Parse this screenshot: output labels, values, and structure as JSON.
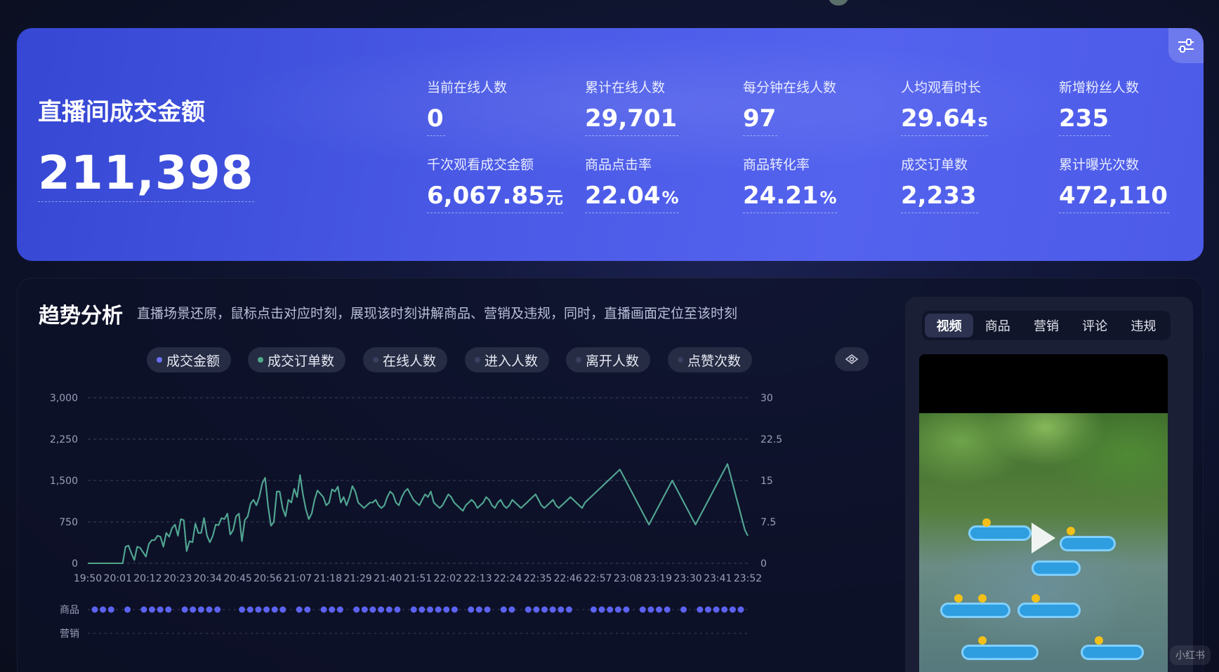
{
  "hero": {
    "title": "直播间成交金额",
    "value": "211,398",
    "metrics": [
      {
        "label": "当前在线人数",
        "value": "0",
        "unit": ""
      },
      {
        "label": "累计在线人数",
        "value": "29,701",
        "unit": ""
      },
      {
        "label": "每分钟在线人数",
        "value": "97",
        "unit": ""
      },
      {
        "label": "人均观看时长",
        "value": "29.64",
        "unit": "s"
      },
      {
        "label": "新增粉丝人数",
        "value": "235",
        "unit": ""
      },
      {
        "label": "千次观看成交金额",
        "value": "6,067.85",
        "unit": "元"
      },
      {
        "label": "商品点击率",
        "value": "22.04",
        "unit": "%"
      },
      {
        "label": "商品转化率",
        "value": "24.21",
        "unit": "%"
      },
      {
        "label": "成交订单数",
        "value": "2,233",
        "unit": ""
      },
      {
        "label": "累计曝光次数",
        "value": "472,110",
        "unit": ""
      }
    ]
  },
  "trend": {
    "title": "趋势分析",
    "description": "直播场景还原，鼠标点击对应时刻，展现该时刻讲解商品、营销及违规，同时，直播画面定位至该时刻",
    "legend": [
      {
        "label": "成交金额",
        "color": "#6a6ff5"
      },
      {
        "label": "成交订单数",
        "color": "#4fa88a"
      },
      {
        "label": "在线人数",
        "color": "#3a4060"
      },
      {
        "label": "进入人数",
        "color": "#3a4060"
      },
      {
        "label": "离开人数",
        "color": "#3a4060"
      },
      {
        "label": "点赞次数",
        "color": "#3a4060"
      }
    ],
    "row_labels": [
      "商品",
      "营销"
    ]
  },
  "video_panel": {
    "tabs": [
      "视频",
      "商品",
      "营销",
      "评论",
      "违规"
    ],
    "active_tab": "视频"
  },
  "watermark": "小红书",
  "chart_data": {
    "type": "line",
    "x_ticks": [
      "19:50",
      "20:01",
      "20:12",
      "20:23",
      "20:34",
      "20:45",
      "20:56",
      "21:07",
      "21:18",
      "21:29",
      "21:40",
      "21:51",
      "22:02",
      "22:13",
      "22:24",
      "22:35",
      "22:46",
      "22:57",
      "23:08",
      "23:19",
      "23:30",
      "23:41",
      "23:52"
    ],
    "ylim_left": [
      0,
      3000
    ],
    "yticks_left": [
      "0",
      "750",
      "1,500",
      "2,250",
      "3,000"
    ],
    "ylim_right": [
      0,
      30
    ],
    "yticks_right": [
      "0",
      "7.5",
      "15",
      "22.5",
      "30"
    ],
    "series": [
      {
        "name": "成交金额",
        "color": "#6a6ff5",
        "axis": "left",
        "values": [
          0,
          0,
          0,
          0,
          0,
          0,
          0,
          0,
          0,
          0,
          0,
          0,
          0,
          300,
          320,
          180,
          60,
          300,
          280,
          200,
          120,
          350,
          420,
          420,
          500,
          480,
          300,
          550,
          480,
          640,
          700,
          500,
          800,
          780,
          220,
          400,
          380,
          720,
          550,
          550,
          820,
          500,
          380,
          500,
          700,
          690,
          820,
          800,
          900,
          520,
          600,
          850,
          900,
          400,
          780,
          850,
          1080,
          1150,
          1050,
          1200,
          1450,
          1550,
          1040,
          680,
          750,
          1300,
          1300,
          1000,
          850,
          1150,
          1100,
          1350,
          1200,
          1600,
          1250,
          980,
          800,
          900,
          1150,
          1320,
          1260,
          1200,
          1050,
          1100,
          1340,
          1300,
          1390,
          1100,
          1200,
          1050,
          1200,
          1400,
          1300,
          1100,
          1050,
          1000,
          1050,
          1100,
          1100,
          1150,
          1050,
          1000,
          1050,
          1200,
          1300,
          1250,
          1100,
          1050,
          1200,
          1300,
          1350,
          1250,
          1150,
          1100,
          1050,
          1150,
          1250,
          1200,
          1300,
          1100,
          1050,
          1000,
          1050,
          1150,
          1250,
          1200,
          1100,
          1050,
          1000,
          950,
          1050,
          1100,
          1150,
          1100,
          1000,
          1050,
          1100,
          1200,
          1150,
          1050,
          1000,
          1100,
          1150,
          1050,
          1000,
          1050,
          1150,
          1100,
          1050,
          1000,
          1050,
          1100,
          1150,
          1200,
          1250,
          1150,
          1050,
          1000,
          1050,
          1100,
          1150,
          1050,
          1000,
          1050,
          1100,
          1150,
          1200,
          1150,
          1100,
          1050,
          1000,
          1100,
          1150,
          1200,
          1250,
          1300,
          1350,
          1400,
          1450,
          1500,
          1550,
          1600,
          1650,
          1700,
          1600,
          1500,
          1400,
          1300,
          1200,
          1100,
          1000,
          900,
          800,
          700,
          800,
          900,
          1000,
          1100,
          1200,
          1300,
          1400,
          1500,
          1400,
          1300,
          1200,
          1100,
          1000,
          900,
          800,
          700,
          800,
          900,
          1000,
          1100,
          1200,
          1300,
          1400,
          1500,
          1600,
          1700,
          1800,
          1600,
          1400,
          1200,
          1000,
          800,
          600,
          500
        ]
      },
      {
        "name": "成交订单数",
        "color": "#4fa88a",
        "axis": "right",
        "values": [
          0,
          0,
          0,
          0,
          0,
          0,
          0,
          0,
          0,
          0,
          0,
          0,
          0,
          3,
          3.2,
          1.8,
          0.6,
          3,
          2.8,
          2,
          1.2,
          3.5,
          4.2,
          4.2,
          5,
          4.8,
          3,
          5.5,
          4.8,
          6.4,
          7,
          5,
          8,
          7.8,
          2.2,
          4,
          3.8,
          7.2,
          5.5,
          5.5,
          8.2,
          5,
          3.8,
          5,
          7,
          6.9,
          8.2,
          8,
          9,
          5.2,
          6,
          8.5,
          9,
          4,
          7.8,
          8.5,
          10.8,
          11.5,
          10.5,
          12,
          14.5,
          15.5,
          10.4,
          6.8,
          7.5,
          13,
          13,
          10,
          8.5,
          11.5,
          11,
          13.5,
          12,
          16,
          12.5,
          9.8,
          8,
          9,
          11.5,
          13.2,
          12.6,
          12,
          10.5,
          11,
          13.4,
          13,
          13.9,
          11,
          12,
          10.5,
          12,
          14,
          13,
          11,
          10.5,
          10,
          10.5,
          11,
          11,
          11.5,
          10.5,
          10,
          10.5,
          12,
          13,
          12.5,
          11,
          10.5,
          12,
          13,
          13.5,
          12.5,
          11.5,
          11,
          10.5,
          11.5,
          12.5,
          12,
          13,
          11,
          10.5,
          10,
          10.5,
          11.5,
          12.5,
          12,
          11,
          10.5,
          10,
          9.5,
          10.5,
          11,
          11.5,
          11,
          10,
          10.5,
          11,
          12,
          11.5,
          10.5,
          10,
          11,
          11.5,
          10.5,
          10,
          10.5,
          11.5,
          11,
          10.5,
          10,
          10.5,
          11,
          11.5,
          12,
          12.5,
          11.5,
          10.5,
          10,
          10.5,
          11,
          11.5,
          10.5,
          10,
          10.5,
          11,
          11.5,
          12,
          11.5,
          11,
          10.5,
          10,
          11,
          11.5,
          12,
          12.5,
          13,
          13.5,
          14,
          14.5,
          15,
          15.5,
          16,
          16.5,
          17,
          16,
          15,
          14,
          13,
          12,
          11,
          10,
          9,
          8,
          7,
          8,
          9,
          10,
          11,
          12,
          13,
          14,
          15,
          14,
          13,
          12,
          11,
          10,
          9,
          8,
          7,
          8,
          9,
          10,
          11,
          12,
          13,
          14,
          15,
          16,
          17,
          18,
          16,
          14,
          12,
          10,
          8,
          6,
          5
        ]
      }
    ],
    "xlabel": "",
    "ylabel": ""
  }
}
